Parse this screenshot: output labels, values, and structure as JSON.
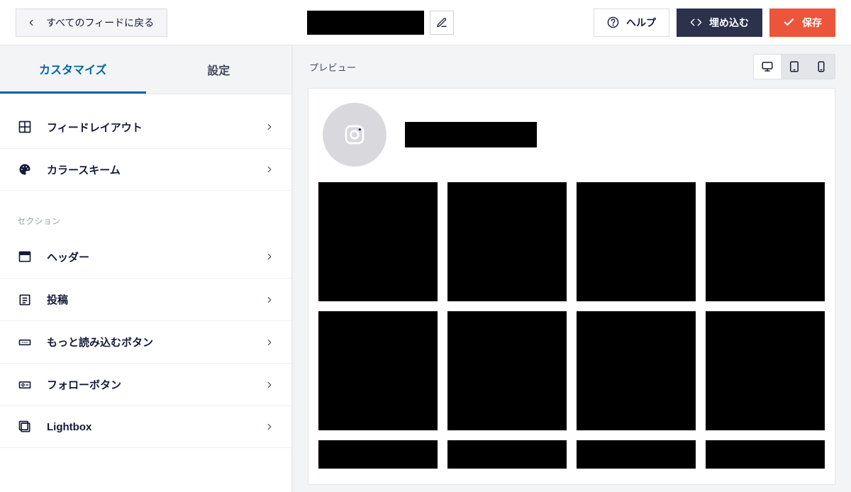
{
  "topbar": {
    "back_label": "すべてのフィードに戻る",
    "help_label": "ヘルプ",
    "embed_label": "埋め込む",
    "save_label": "保存"
  },
  "tabs": {
    "customize_label": "カスタマイズ",
    "settings_label": "設定"
  },
  "sidebar": {
    "section_label": "セクション",
    "primary": [
      {
        "icon": "layout-icon",
        "label": "フィードレイアウト"
      },
      {
        "icon": "palette-icon",
        "label": "カラースキーム"
      }
    ],
    "sections": [
      {
        "icon": "header-icon",
        "label": "ヘッダー"
      },
      {
        "icon": "post-icon",
        "label": "投稿"
      },
      {
        "icon": "loadmore-icon",
        "label": "もっと読み込むボタン"
      },
      {
        "icon": "follow-icon",
        "label": "フォローボタン"
      },
      {
        "icon": "lightbox-icon",
        "label": "Lightbox"
      }
    ]
  },
  "preview": {
    "title": "プレビュー",
    "devices": {
      "desktop": "desktop",
      "tablet": "tablet",
      "mobile": "mobile"
    },
    "post_count": 12
  }
}
